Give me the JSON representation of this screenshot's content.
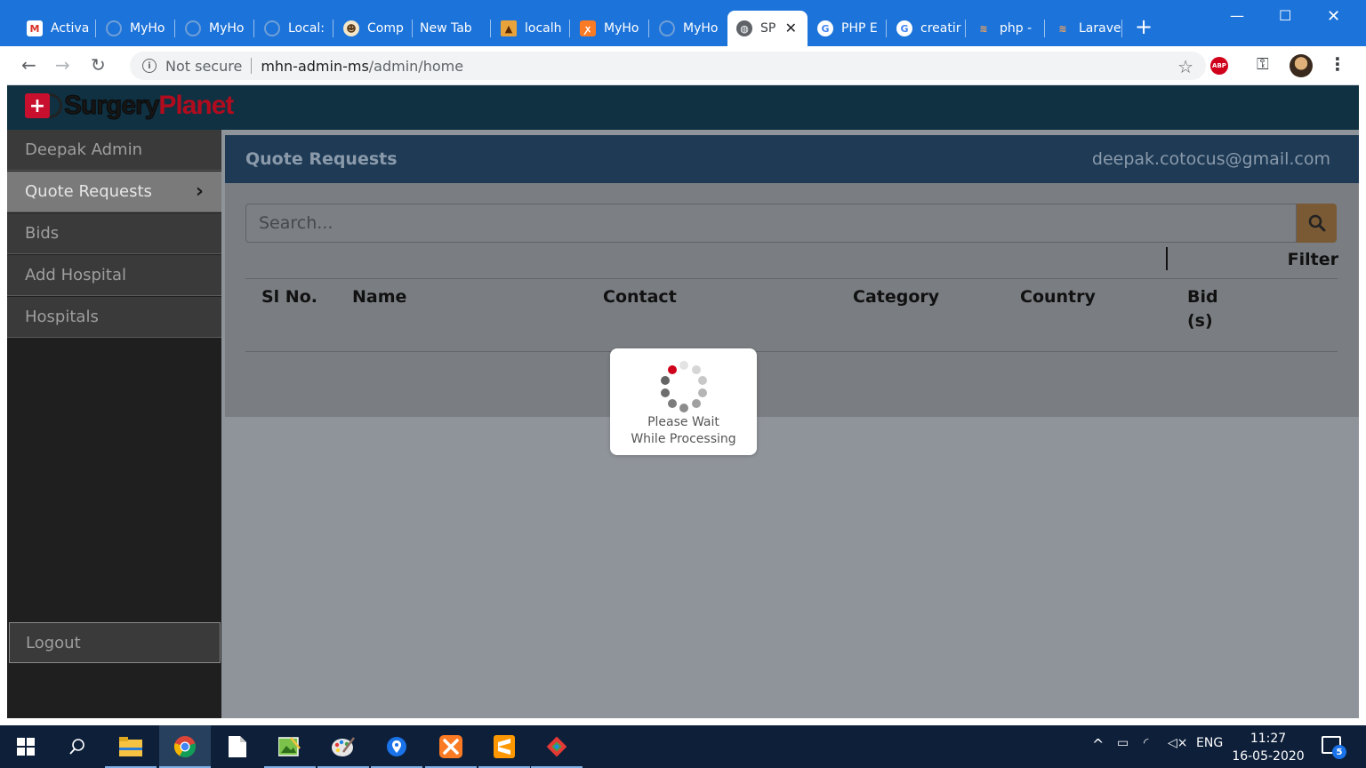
{
  "browser": {
    "tabs": [
      {
        "title": "Activa",
        "icon": "gmail-icon"
      },
      {
        "title": "MyHo",
        "icon": "globe-icon"
      },
      {
        "title": "MyHo",
        "icon": "globe-icon"
      },
      {
        "title": "Local:",
        "icon": "globe-icon"
      },
      {
        "title": "Comp",
        "icon": "composer-icon"
      },
      {
        "title": "New Tab",
        "icon": ""
      },
      {
        "title": "localh",
        "icon": "xampp-icon"
      },
      {
        "title": "MyHo",
        "icon": "xampp-icon"
      },
      {
        "title": "MyHo",
        "icon": "globe-icon"
      },
      {
        "title": "SP",
        "icon": "globe-icon",
        "active": true
      },
      {
        "title": "PHP E",
        "icon": "google-icon"
      },
      {
        "title": "creatir",
        "icon": "google-icon"
      },
      {
        "title": "php -",
        "icon": "stackoverflow-icon"
      },
      {
        "title": "Larave",
        "icon": "stackoverflow-icon"
      }
    ],
    "address": {
      "security_label": "Not secure",
      "host": "mhn-admin-ms",
      "path": "/admin/home"
    },
    "extension_abp": "ABP"
  },
  "app": {
    "logo_word1": "Surgery",
    "logo_word2": "Planet",
    "sidebar": {
      "items": [
        {
          "label": "Deepak Admin"
        },
        {
          "label": "Quote Requests",
          "active": true
        },
        {
          "label": "Bids"
        },
        {
          "label": "Add Hospital"
        },
        {
          "label": "Hospitals"
        }
      ],
      "logout_label": "Logout"
    },
    "panel": {
      "title": "Quote Requests",
      "user_email": "deepak.cotocus@gmail.com",
      "search_placeholder": "Search...",
      "filter_label": "Filter",
      "columns": [
        "Sl No.",
        "Name",
        "Contact",
        "Category",
        "Country",
        "Bid",
        "(s)"
      ]
    },
    "loader": {
      "line1": "Please Wait",
      "line2": "While Processing"
    }
  },
  "taskbar": {
    "language": "ENG",
    "time": "11:27",
    "date": "16-05-2020",
    "notification_count": "5"
  },
  "colors": {
    "tabbar": "#1c73d9",
    "app_header": "#0f3142",
    "panel_header": "#1e3a55",
    "loader_active_dot": "#d0021b"
  }
}
